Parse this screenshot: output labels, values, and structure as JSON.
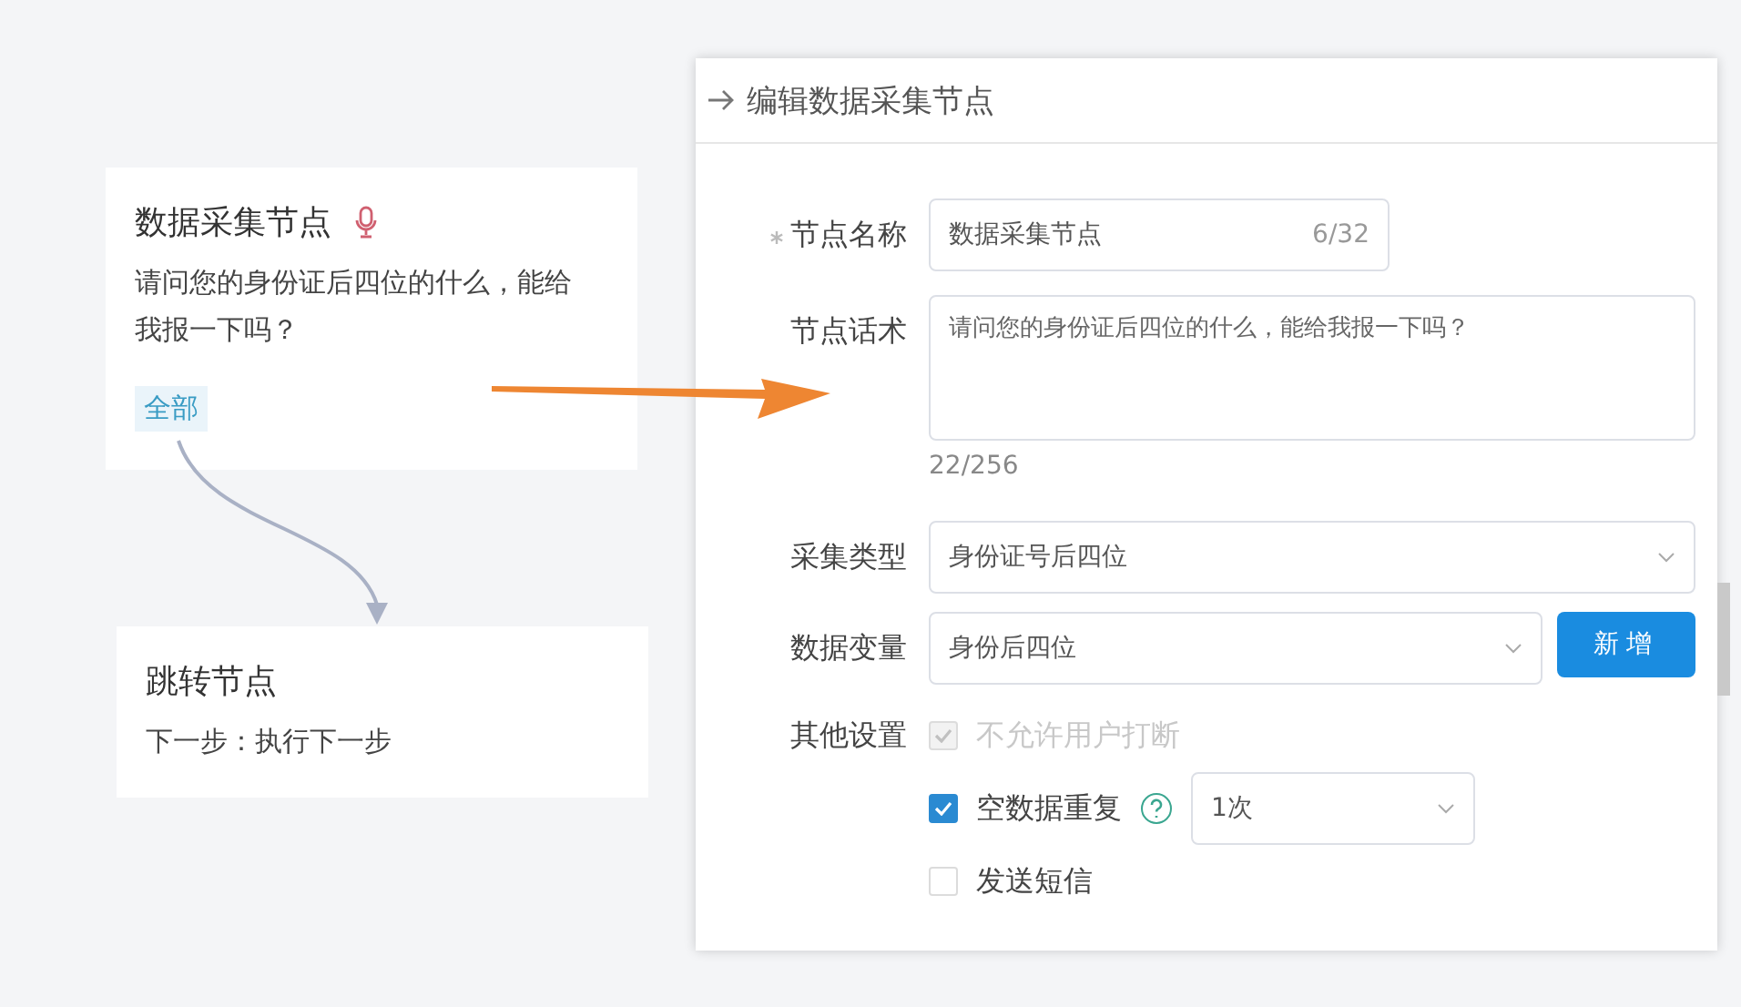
{
  "canvas": {
    "nodes": [
      {
        "kind": "collect",
        "title": "数据采集节点",
        "text": "请问您的身份证后四位的什么，能给我报一下吗？",
        "tags": [
          "全部"
        ]
      },
      {
        "kind": "jump",
        "title": "跳转节点",
        "text": "下一步：执行下一步"
      }
    ]
  },
  "panel": {
    "title": "编辑数据采集节点",
    "name_field": {
      "label": "节点名称",
      "required": true,
      "value": "数据采集节点",
      "count": "6/32"
    },
    "script_field": {
      "label": "节点话术",
      "value": "请问您的身份证后四位的什么，能给我报一下吗？",
      "count": "22/256"
    },
    "collect_type": {
      "label": "采集类型",
      "value": "身份证号后四位"
    },
    "variable": {
      "label": "数据变量",
      "value": "身份后四位",
      "button": "新增"
    },
    "other": {
      "label": "其他设置",
      "options": [
        {
          "kind": "plain",
          "label": "不允许用户打断",
          "checked": true,
          "disabled": true
        },
        {
          "kind": "repeat",
          "label": "空数据重复",
          "checked": true,
          "disabled": false,
          "select": "1次"
        },
        {
          "kind": "plain",
          "label": "发送短信",
          "checked": false,
          "disabled": false
        }
      ]
    }
  }
}
